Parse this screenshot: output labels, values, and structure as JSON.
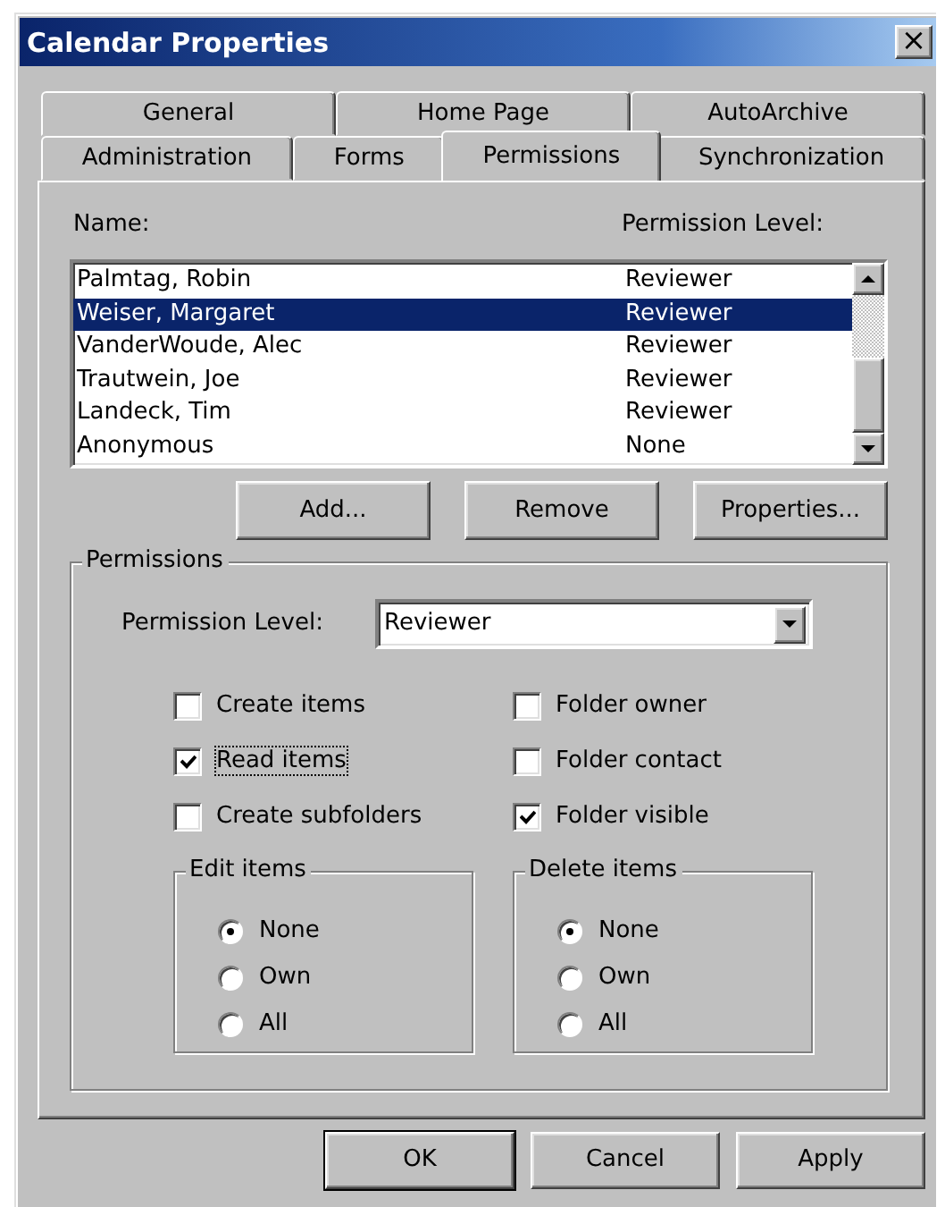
{
  "window": {
    "title": "Calendar Properties",
    "close_label": "×"
  },
  "tab_rows": [
    {
      "tabs": [
        {
          "label": "General",
          "selected": false
        },
        {
          "label": "Home Page",
          "selected": false
        },
        {
          "label": "AutoArchive",
          "selected": false
        }
      ]
    },
    {
      "tabs": [
        {
          "label": "Administration",
          "selected": false
        },
        {
          "label": "Forms",
          "selected": false
        },
        {
          "label": "Permissions",
          "selected": true
        },
        {
          "label": "Synchronization",
          "selected": false
        }
      ]
    }
  ],
  "permission_list": {
    "columns": [
      "Name:",
      "Permission Level:"
    ],
    "rows": [
      {
        "name": "Palmtag, Robin",
        "permission": "Reviewer",
        "selected": false
      },
      {
        "name": "Weiser, Margaret",
        "permission": "Reviewer",
        "selected": true
      },
      {
        "name": "VanderWoude, Alec",
        "permission": "Reviewer",
        "selected": false
      },
      {
        "name": "Trautwein, Joe",
        "permission": "Reviewer",
        "selected": false
      },
      {
        "name": "Landeck, Tim",
        "permission": "Reviewer",
        "selected": false
      },
      {
        "name": "Anonymous",
        "permission": "None",
        "selected": false
      }
    ]
  },
  "list_buttons": [
    "Add...",
    "Remove",
    "Properties..."
  ],
  "permissions_group": {
    "title": "Permissions",
    "permission_level": {
      "label": "Permission Level:",
      "value": "Reviewer"
    },
    "checkboxes": [
      {
        "label": "Create items",
        "checked": false,
        "focused": false
      },
      {
        "label": "Folder owner",
        "checked": false,
        "focused": false
      },
      {
        "label": "Read items",
        "checked": true,
        "focused": true
      },
      {
        "label": "Folder contact",
        "checked": false,
        "focused": false
      },
      {
        "label": "Create subfolders",
        "checked": false,
        "focused": false
      },
      {
        "label": "Folder visible",
        "checked": true,
        "focused": false
      }
    ],
    "option_groups": [
      {
        "title": "Edit items",
        "options": [
          {
            "label": "None",
            "selected": true
          },
          {
            "label": "Own",
            "selected": false
          },
          {
            "label": "All",
            "selected": false
          }
        ]
      },
      {
        "title": "Delete items",
        "options": [
          {
            "label": "None",
            "selected": true
          },
          {
            "label": "Own",
            "selected": false
          },
          {
            "label": "All",
            "selected": false
          }
        ]
      }
    ]
  },
  "footer_buttons": [
    {
      "label": "OK",
      "default": true
    },
    {
      "label": "Cancel",
      "default": false
    },
    {
      "label": "Apply",
      "default": false
    }
  ]
}
